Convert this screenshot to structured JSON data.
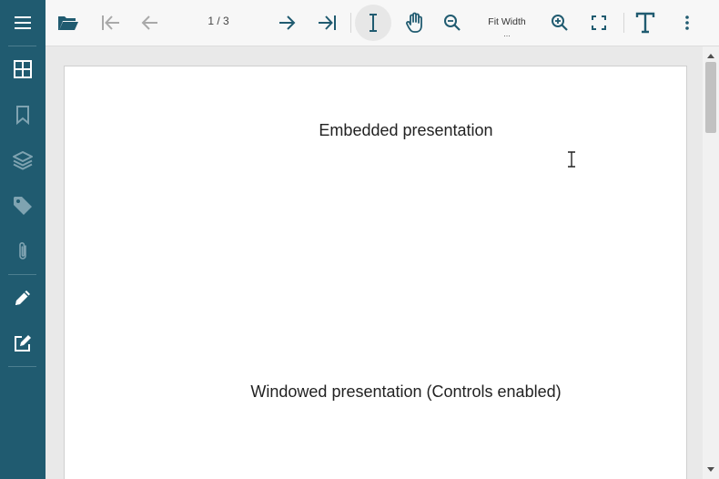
{
  "toolbar": {
    "page_indicator": "1 / 3",
    "zoom_label": "Fit Width",
    "zoom_more": "..."
  },
  "document": {
    "texts": [
      "Embedded presentation",
      "Windowed presentation (Controls enabled)"
    ]
  },
  "colors": {
    "sidebar": "#205b70",
    "toolbar_icon": "#205b70",
    "disabled_icon": "#a9a9a9"
  }
}
